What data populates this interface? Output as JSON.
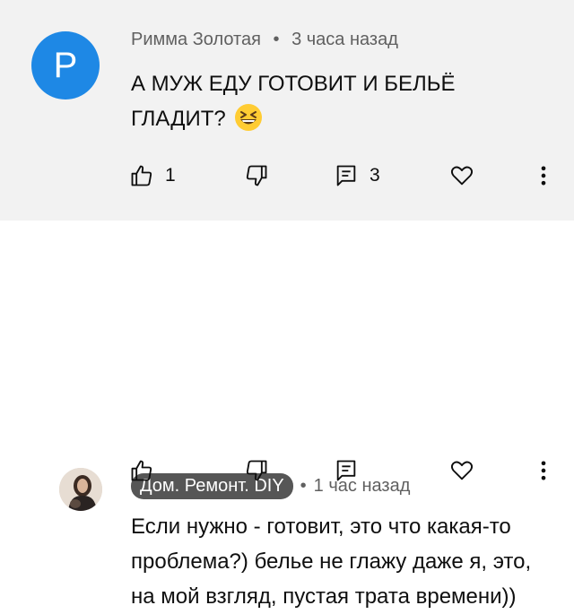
{
  "comments": [
    {
      "avatar_letter": "P",
      "author": "Римма Золотая",
      "separator": "•",
      "time": "3 часа назад",
      "text": "А МУЖ ЕДУ ГОТОВИТ И БЕЛЬЁ ГЛАДИТ?",
      "emoji": "grinning-squinting-face",
      "like_count": "1",
      "reply_count": "3",
      "background": "#f2f2f2",
      "avatar_color": "#1e88e5"
    },
    {
      "author": "Дом. Ремонт. DIY",
      "separator": "•",
      "time": "1 час назад",
      "text": "Если нужно - готовит, это что какая-то проблема?) белье не глажу даже я, это, на мой взгляд, пустая трата времени))",
      "author_badge_color": "#565656"
    }
  ],
  "icons": [
    "thumb-up-icon",
    "thumb-down-icon",
    "reply-icon",
    "heart-icon",
    "more-vert-icon"
  ]
}
